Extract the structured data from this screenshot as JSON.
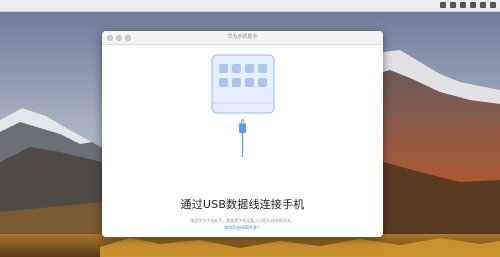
{
  "window": {
    "title": "华为手机助手"
  },
  "main": {
    "headline": "通过USB数据线连接手机",
    "description": "使用华为手机助手，需要将手机设备上已经开启HDB开关。",
    "help_link": "如何开启HDB开关？"
  },
  "colors": {
    "accent_blue": "#3a7be0",
    "phone_tile": "#a9c6f3",
    "phone_body": "#e6effd"
  },
  "icons": [
    "phone-icon",
    "usb-cable-icon"
  ]
}
